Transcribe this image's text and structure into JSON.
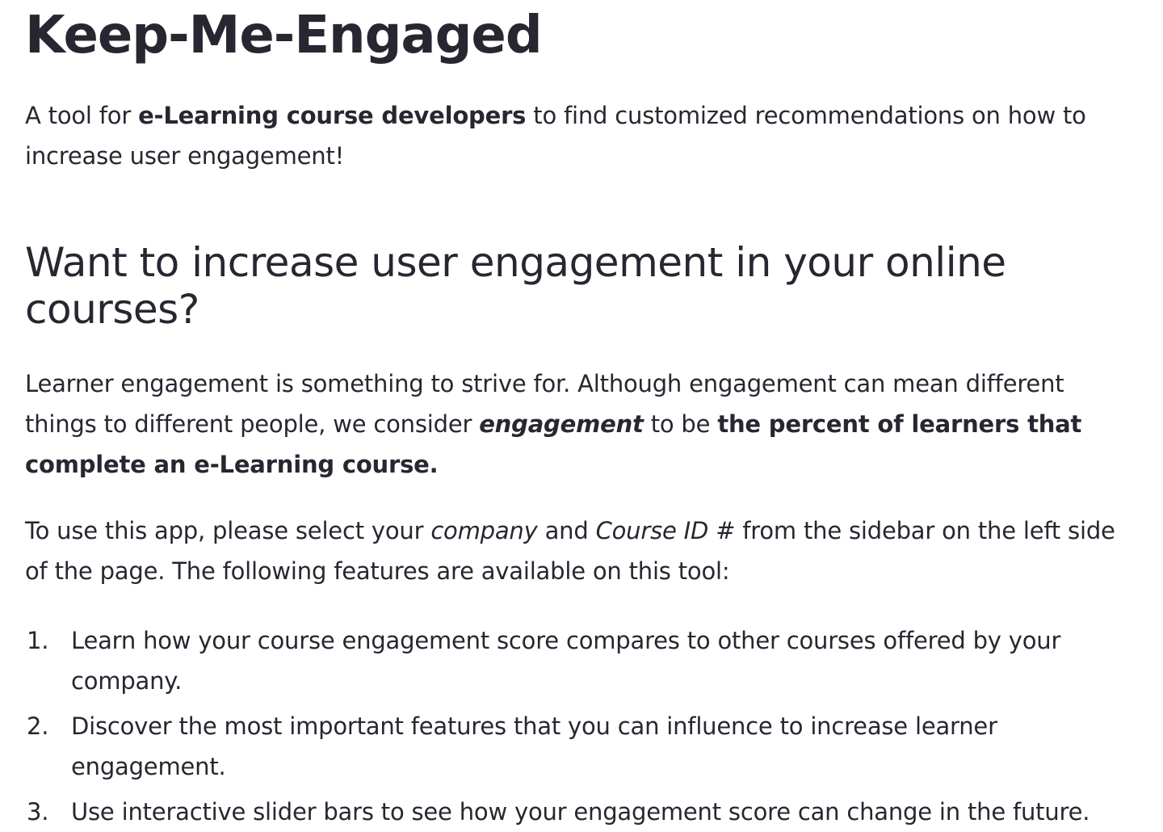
{
  "title": "Keep-Me-Engaged",
  "intro": {
    "before": "A tool for ",
    "bold": "e-Learning course developers",
    "after": " to find customized recommendations on how to increase user engagement!"
  },
  "subtitle": "Want to increase user engagement in your online courses?",
  "paragraph1": {
    "part1": "Learner engagement is something to strive for. Although engagement can mean different things to different people, we consider ",
    "italic_bold": "engagement",
    "part2": " to be ",
    "bold": "the percent of learners that complete an e-Learning course."
  },
  "paragraph2": {
    "part1": "To use this app, please select your ",
    "italic1": "company",
    "part2": " and ",
    "italic2": "Course ID #",
    "part3": " from the sidebar on the left side of the page. The following features are available on this tool:"
  },
  "features": [
    {
      "num": "1.",
      "text": "Learn how your course engagement score compares to other courses offered by your company."
    },
    {
      "num": "2.",
      "text": "Discover the most important features that you can influence to increase learner engagement."
    },
    {
      "num": "3.",
      "text": "Use interactive slider bars to see how your engagement score can change in the future."
    }
  ]
}
